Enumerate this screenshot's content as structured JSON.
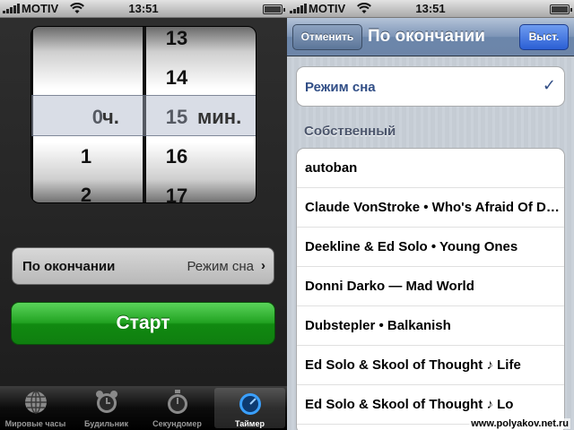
{
  "left": {
    "status": {
      "carrier": "MOTIV",
      "time": "13:51"
    },
    "picker": {
      "hours_col": [
        "",
        "",
        "0",
        "1",
        "2"
      ],
      "minutes_col": [
        "13",
        "14",
        "15",
        "16",
        "17"
      ],
      "hour_unit": "ч.",
      "minute_unit": "мин."
    },
    "ending_row": {
      "label": "По окончании",
      "value": "Режим сна"
    },
    "start_button": "Старт",
    "tabs": [
      {
        "label": "Мировые часы",
        "icon": "globe-icon"
      },
      {
        "label": "Будильник",
        "icon": "alarm-clock-icon"
      },
      {
        "label": "Секундомер",
        "icon": "stopwatch-icon"
      },
      {
        "label": "Таймер",
        "icon": "timer-icon",
        "active": true
      }
    ]
  },
  "right": {
    "status": {
      "carrier": "MOTIV",
      "time": "13:51"
    },
    "nav": {
      "cancel": "Отменить",
      "title": "По окончании",
      "done": "Выст."
    },
    "selected_item": "Режим сна",
    "section_header": "Собственный",
    "songs": [
      "autoban",
      "Claude VonStroke • Who's Afraid Of Detroit",
      "Deekline & Ed Solo • Young Ones",
      "Donni Darko — Mad World",
      "Dubstepler • Balkanish",
      "Ed Solo & Skool of Thought ♪ Life",
      "Ed Solo & Skool of Thought ♪ Lo"
    ]
  },
  "watermark": "www.polyakov.net.ru",
  "colors": {
    "start_green": "#1a9a1a",
    "nav_blue": "#6d85a8",
    "done_blue": "#2b5fd4",
    "selected_text": "#314e86"
  }
}
